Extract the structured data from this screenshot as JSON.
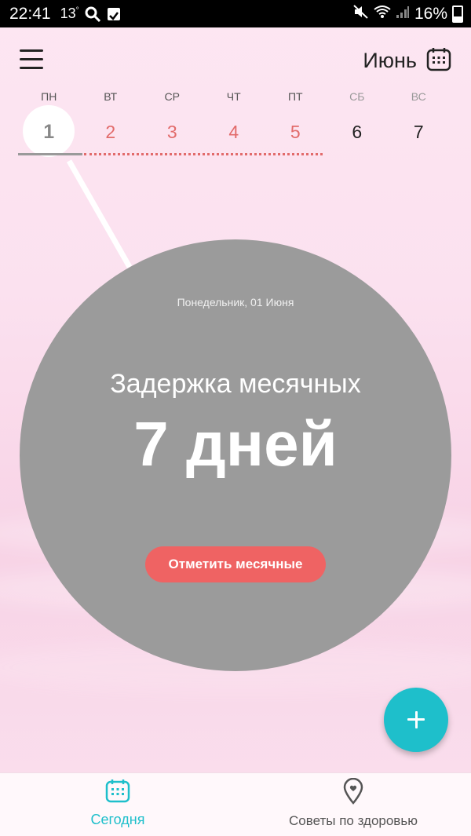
{
  "status_bar": {
    "time": "22:41",
    "temperature": "13",
    "degree": "°",
    "battery": "16%"
  },
  "header": {
    "month_label": "Июнь"
  },
  "week": {
    "weekdays": [
      "ПН",
      "ВТ",
      "СР",
      "ЧТ",
      "ПТ",
      "СБ",
      "ВС"
    ],
    "dates": [
      "1",
      "2",
      "3",
      "4",
      "5",
      "6",
      "7"
    ],
    "selected_index": 0,
    "period_days": [
      1,
      2,
      3,
      4
    ]
  },
  "circle": {
    "date_label": "Понедельник, 01 Июня",
    "title": "Задержка месячных",
    "value": "7 дней",
    "button_label": "Отметить месячные"
  },
  "bottom_nav": {
    "today_label": "Сегодня",
    "tips_label": "Советы по здоровью"
  },
  "colors": {
    "accent": "#1ebfcb",
    "period": "#e26b6b",
    "button": "#ef6363",
    "circle": "#9b9b9b"
  },
  "icons": {
    "menu": "menu-icon",
    "calendar": "calendar-icon",
    "add": "plus-icon",
    "tips": "location-heart-icon"
  }
}
